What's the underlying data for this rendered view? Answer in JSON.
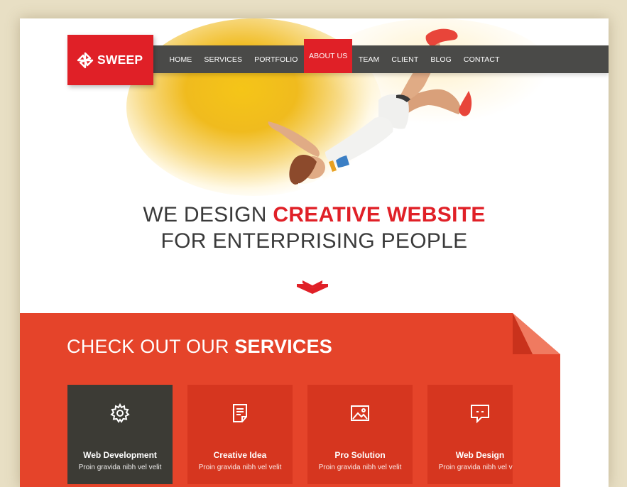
{
  "brand": {
    "name": "SWEEP",
    "color": "#e02027"
  },
  "nav": {
    "items": [
      {
        "label": "HOME"
      },
      {
        "label": "SERVICES"
      },
      {
        "label": "PORTFOLIO"
      },
      {
        "label": "ABOUT US",
        "active": true
      },
      {
        "label": "TEAM"
      },
      {
        "label": "CLIENT"
      },
      {
        "label": "BLOG"
      },
      {
        "label": "CONTACT"
      }
    ]
  },
  "hero": {
    "line1_prefix": "WE DESIGN",
    "line1_accent": "CREATIVE WEBSITE",
    "line2": "FOR ENTERPRISING PEOPLE"
  },
  "services": {
    "title_prefix": "CHECK OUT OUR",
    "title_bold": "SERVICES",
    "cards": [
      {
        "icon": "gear-icon",
        "title": "Web Development",
        "desc": "Proin gravida nibh vel velit"
      },
      {
        "icon": "document-icon",
        "title": "Creative Idea",
        "desc": "Proin gravida nibh vel velit"
      },
      {
        "icon": "image-icon",
        "title": "Pro Solution",
        "desc": "Proin gravida nibh vel velit"
      },
      {
        "icon": "chat-icon",
        "title": "Web Design",
        "desc": "Proin gravida nibh vel velit"
      }
    ]
  },
  "colors": {
    "accent": "#e02027",
    "services_bg": "#e5442a",
    "card_bg": "#d6361f",
    "card_dark": "#3c3b35",
    "nav_bg": "#4a4a48",
    "backdrop": "#e8dfc4"
  }
}
